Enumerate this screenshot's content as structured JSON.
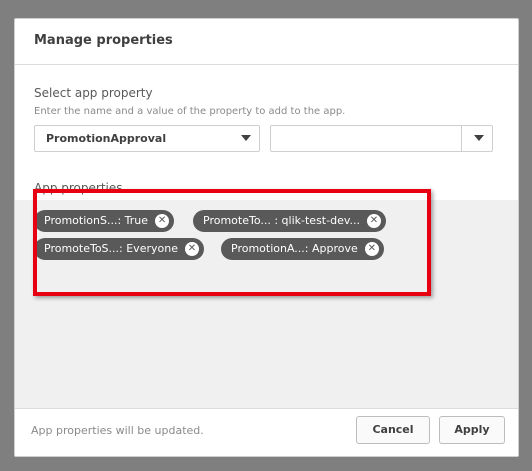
{
  "dialog": {
    "title": "Manage properties",
    "select": {
      "label": "Select app property",
      "hint": "Enter the name and a value of the property to add to the app.",
      "property_value": "PromotionApproval",
      "value_field": ""
    },
    "app_properties": {
      "label": "App properties",
      "chips": [
        {
          "label": "PromotionS...: True"
        },
        {
          "label": "PromoteTo...  : qlik-test-dev..."
        },
        {
          "label": "PromoteToS...: Everyone"
        },
        {
          "label": "PromotionA...: Approve"
        }
      ]
    },
    "footer": {
      "status": "App properties will be updated.",
      "cancel": "Cancel",
      "apply": "Apply"
    }
  },
  "colors": {
    "chip_bg": "#595959",
    "highlight": "#e60012"
  },
  "icons": {
    "chip_remove": "close-circle-icon",
    "dropdown": "caret-down-icon"
  }
}
